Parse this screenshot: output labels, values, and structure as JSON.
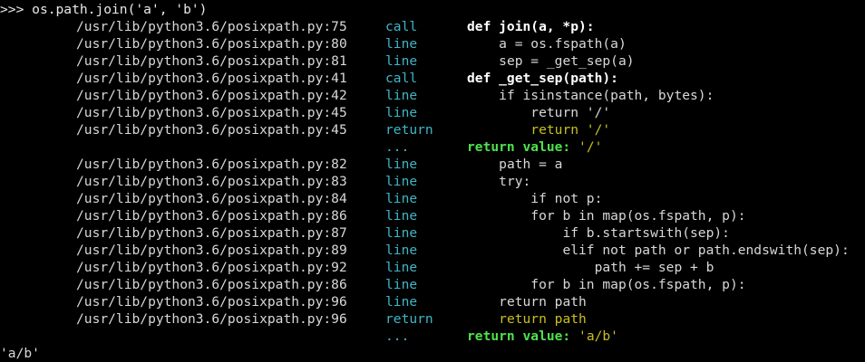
{
  "prompt": {
    "symbol": ">>>",
    "command": "os.path.join('a', 'b')"
  },
  "colors": {
    "background": "#000000",
    "text": "#d8d8d8",
    "event": "#3fb6c6",
    "return_value": "#4ee24e",
    "returned_source": "#c8c020"
  },
  "trace": [
    {
      "path": "/usr/lib/python3.6/posixpath.py:75",
      "event": "call",
      "source": "def join(a, *p):",
      "indent": 0,
      "style": "def"
    },
    {
      "path": "/usr/lib/python3.6/posixpath.py:80",
      "event": "line",
      "source": "a = os.fspath(a)",
      "indent": 1,
      "style": "plain"
    },
    {
      "path": "/usr/lib/python3.6/posixpath.py:81",
      "event": "line",
      "source": "sep = _get_sep(a)",
      "indent": 1,
      "style": "plain"
    },
    {
      "path": "/usr/lib/python3.6/posixpath.py:41",
      "event": "call",
      "source": "def _get_sep(path):",
      "indent": 0,
      "style": "def"
    },
    {
      "path": "/usr/lib/python3.6/posixpath.py:42",
      "event": "line",
      "source": "if isinstance(path, bytes):",
      "indent": 1,
      "style": "plain"
    },
    {
      "path": "/usr/lib/python3.6/posixpath.py:45",
      "event": "line",
      "source": "return '/'",
      "indent": 2,
      "style": "plain"
    },
    {
      "path": "/usr/lib/python3.6/posixpath.py:45",
      "event": "return",
      "source": "return '/'",
      "indent": 2,
      "style": "returned"
    },
    {
      "path": "",
      "event": "...",
      "source_label": "return value:",
      "source_value": "'/'",
      "indent": 0,
      "style": "retval"
    },
    {
      "path": "/usr/lib/python3.6/posixpath.py:82",
      "event": "line",
      "source": "path = a",
      "indent": 1,
      "style": "plain"
    },
    {
      "path": "/usr/lib/python3.6/posixpath.py:83",
      "event": "line",
      "source": "try:",
      "indent": 1,
      "style": "plain"
    },
    {
      "path": "/usr/lib/python3.6/posixpath.py:84",
      "event": "line",
      "source": "if not p:",
      "indent": 2,
      "style": "plain"
    },
    {
      "path": "/usr/lib/python3.6/posixpath.py:86",
      "event": "line",
      "source": "for b in map(os.fspath, p):",
      "indent": 2,
      "style": "plain"
    },
    {
      "path": "/usr/lib/python3.6/posixpath.py:87",
      "event": "line",
      "source": "if b.startswith(sep):",
      "indent": 3,
      "style": "plain"
    },
    {
      "path": "/usr/lib/python3.6/posixpath.py:89",
      "event": "line",
      "source": "elif not path or path.endswith(sep):",
      "indent": 3,
      "style": "plain"
    },
    {
      "path": "/usr/lib/python3.6/posixpath.py:92",
      "event": "line",
      "source": "path += sep + b",
      "indent": 4,
      "style": "plain"
    },
    {
      "path": "/usr/lib/python3.6/posixpath.py:86",
      "event": "line",
      "source": "for b in map(os.fspath, p):",
      "indent": 2,
      "style": "plain"
    },
    {
      "path": "/usr/lib/python3.6/posixpath.py:96",
      "event": "line",
      "source": "return path",
      "indent": 1,
      "style": "plain"
    },
    {
      "path": "/usr/lib/python3.6/posixpath.py:96",
      "event": "return",
      "source": "return path",
      "indent": 1,
      "style": "returned"
    },
    {
      "path": "",
      "event": "...",
      "source_label": "return value:",
      "source_value": "'a/b'",
      "indent": 0,
      "style": "retval"
    }
  ],
  "result": "'a/b'"
}
